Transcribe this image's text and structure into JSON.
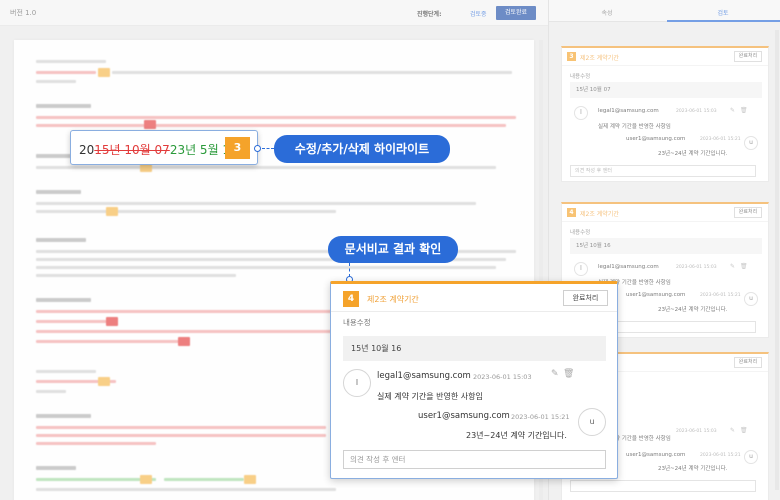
{
  "topbar": {
    "version": "버전 1.0",
    "status_label": "진행단계:",
    "status_value": "검토중",
    "complete_button": "검토완료"
  },
  "panel": {
    "tabs": [
      {
        "label": "속성",
        "active": false
      },
      {
        "label": "검토",
        "active": true
      }
    ],
    "cards": [
      {
        "number": "3",
        "title": "제2조 계약기간",
        "done_label": "완료처리",
        "content_label": "내용수정",
        "quote": "15년 10월 07",
        "comments": [
          {
            "avatar": "l",
            "user": "legal1@samsung.com",
            "date": "2023-06-01 15:03",
            "text": "실제 계약 기간을 반영한 사항임"
          },
          {
            "avatar": "u",
            "user": "user1@samsung.com",
            "date": "2023-06-01 15:21",
            "text": "23년~24년 계약 기간입니다."
          }
        ],
        "input_placeholder": "의견 작성 후 엔터"
      },
      {
        "number": "4",
        "title": "제2조 계약기간",
        "done_label": "완료처리",
        "content_label": "내용수정",
        "quote": "15년 10월 16",
        "comments": [
          {
            "avatar": "l",
            "user": "legal1@samsung.com",
            "date": "2023-06-01 15:03",
            "text": "실제 계약 기간을 반영한 사항임"
          },
          {
            "avatar": "u",
            "user": "user1@samsung.com",
            "date": "2023-06-01 15:21",
            "text": "23년~24년 계약 기간입니다."
          }
        ],
        "input_placeholder": ""
      },
      {
        "number": "",
        "title": "",
        "done_label": "완료처리",
        "comments": [
          {
            "avatar": "l",
            "user": "legal1@samsung.com",
            "date": "2023-06-01 15:03",
            "text": "실제 계약 기간을 반영한 사항임"
          },
          {
            "avatar": "u",
            "user": "user1@samsung.com",
            "date": "2023-06-01 15:21",
            "text": "23년~24년 계약 기간입니다."
          }
        ]
      }
    ]
  },
  "callout_highlight": {
    "prefix": "20",
    "deleted": "15년 10월 07",
    "inserted": "23년 5월 1",
    "badge": "3",
    "pill_label": "수정/추가/삭제 하이라이트"
  },
  "callout_compare": {
    "pill_label": "문서비교 결과 확인",
    "number": "4",
    "title": "제2조 계약기간",
    "done_label": "완료처리",
    "content_label": "내용수정",
    "quote": "15년 10월 16",
    "comments": [
      {
        "avatar": "l",
        "user": "legal1@samsung.com",
        "date": "2023-06-01 15:03",
        "text": "실제 계약 기간을 반영한 사항임"
      },
      {
        "avatar": "u",
        "user": "user1@samsung.com",
        "date": "2023-06-01 15:21",
        "text": "23년~24년 계약 기간입니다."
      }
    ],
    "input_placeholder": "의견 작성 후 엔터"
  },
  "icons": {
    "edit": "edit-icon",
    "delete": "trash-icon"
  },
  "colors": {
    "accent_blue": "#2b6cd8",
    "card_orange": "#f5a32a",
    "deleted_red": "#e23c3c",
    "inserted_green": "#2a9a3a"
  }
}
